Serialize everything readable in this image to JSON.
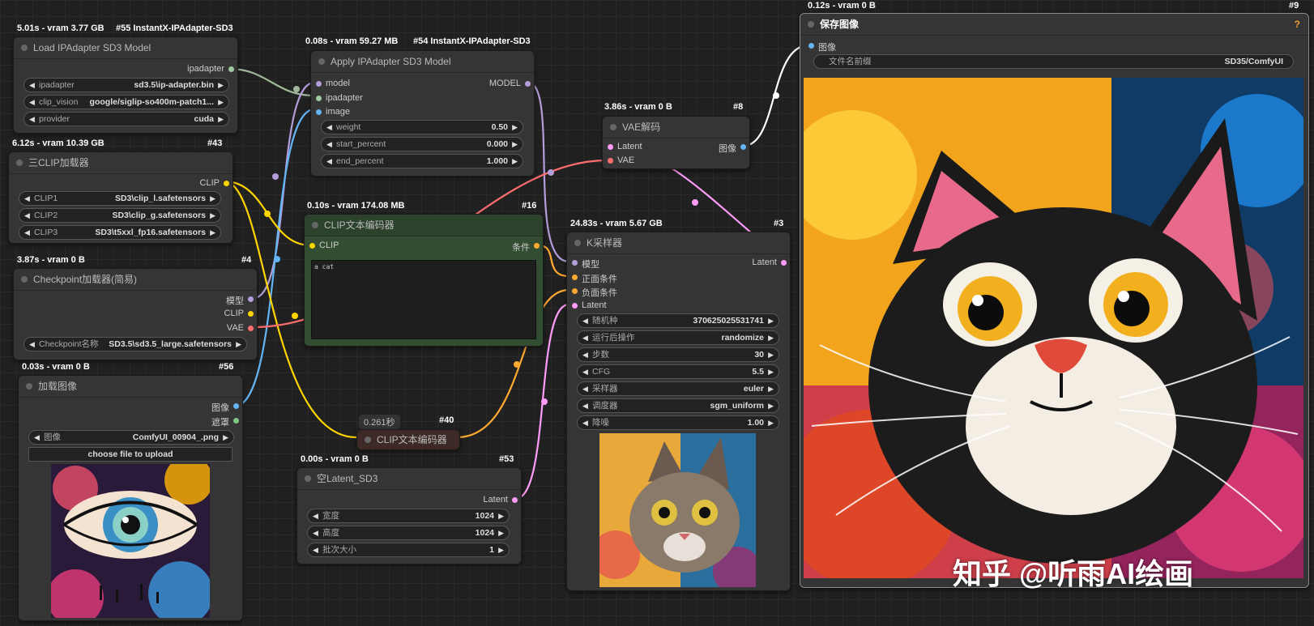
{
  "nodes": {
    "n55": {
      "stats": "5.01s - vram 3.77 GB",
      "id": "#55 InstantX-IPAdapter-SD3",
      "title": "Load IPAdapter SD3 Model",
      "output": "ipadapter",
      "widgets": [
        {
          "label": "ipadapter",
          "value": "sd3.5\\ip-adapter.bin"
        },
        {
          "label": "clip_vision",
          "value": "google/siglip-so400m-patch1..."
        },
        {
          "label": "provider",
          "value": "cuda"
        }
      ]
    },
    "n54": {
      "stats": "0.08s - vram 59.27 MB",
      "id": "#54 InstantX-IPAdapter-SD3",
      "title": "Apply IPAdapter SD3 Model",
      "inputs": [
        "model",
        "ipadapter",
        "image"
      ],
      "output": "MODEL",
      "widgets": [
        {
          "label": "weight",
          "value": "0.50"
        },
        {
          "label": "start_percent",
          "value": "0.000"
        },
        {
          "label": "end_percent",
          "value": "1.000"
        }
      ]
    },
    "n43": {
      "stats": "6.12s - vram 10.39 GB",
      "id": "#43",
      "title": "三CLIP加载器",
      "output": "CLIP",
      "widgets": [
        {
          "label": "CLIP1",
          "value": "SD3\\clip_l.safetensors"
        },
        {
          "label": "CLIP2",
          "value": "SD3\\clip_g.safetensors"
        },
        {
          "label": "CLIP3",
          "value": "SD3\\t5xxl_fp16.safetensors"
        }
      ]
    },
    "n4": {
      "stats": "3.87s - vram 0 B",
      "id": "#4",
      "title": "Checkpoint加载器(简易)",
      "outputs": [
        "模型",
        "CLIP",
        "VAE"
      ],
      "widgets": [
        {
          "label": "Checkpoint名称",
          "value": "SD3.5\\sd3.5_large.safetensors"
        }
      ]
    },
    "n56": {
      "stats": "0.03s - vram 0 B",
      "id": "#56",
      "title": "加载图像",
      "outputs": [
        "图像",
        "遮罩"
      ],
      "widgets": [
        {
          "label": "图像",
          "value": "ComfyUI_00904_.png"
        }
      ],
      "upload": "choose file to upload"
    },
    "n16": {
      "stats": "0.10s - vram 174.08 MB",
      "id": "#16",
      "title": "CLIP文本编码器",
      "input": "CLIP",
      "output": "条件",
      "text": "a cat"
    },
    "n40": {
      "badge": "0.261秒",
      "id": "#40",
      "title": "CLIP文本编码器"
    },
    "n53": {
      "stats": "0.00s - vram 0 B",
      "id": "#53",
      "title": "空Latent_SD3",
      "output": "Latent",
      "widgets": [
        {
          "label": "宽度",
          "value": "1024"
        },
        {
          "label": "高度",
          "value": "1024"
        },
        {
          "label": "批次大小",
          "value": "1"
        }
      ]
    },
    "n8": {
      "stats": "3.86s - vram 0 B",
      "id": "#8",
      "title": "VAE解码",
      "inputs": [
        "Latent",
        "VAE"
      ],
      "output": "图像"
    },
    "n3": {
      "stats": "24.83s - vram 5.67 GB",
      "id": "#3",
      "title": "K采样器",
      "inputs": [
        "模型",
        "正面条件",
        "负面条件",
        "Latent"
      ],
      "output": "Latent",
      "widgets": [
        {
          "label": "随机种",
          "value": "370625025531741"
        },
        {
          "label": "运行后操作",
          "value": "randomize"
        },
        {
          "label": "步数",
          "value": "30"
        },
        {
          "label": "CFG",
          "value": "5.5"
        },
        {
          "label": "采样器",
          "value": "euler"
        },
        {
          "label": "调度器",
          "value": "sgm_uniform"
        },
        {
          "label": "降噪",
          "value": "1.00"
        }
      ]
    },
    "n9": {
      "stats": "0.12s - vram 0 B",
      "id": "#9",
      "title": "保存图像",
      "help": "?",
      "input": "图像",
      "widgets": [
        {
          "label": "文件名前缀",
          "value": "SD35/ComfyUI"
        }
      ]
    }
  },
  "watermark": "知乎 @听雨AI绘画",
  "colors": {
    "model": "#b39ddb",
    "clip": "#ffd500",
    "vae": "#ff6e6e",
    "image": "#64b5f6",
    "latent": "#ff9cf9",
    "conditioning": "#ffa931",
    "ipadapter": "#a0c8a0",
    "mask": "#81c784"
  }
}
